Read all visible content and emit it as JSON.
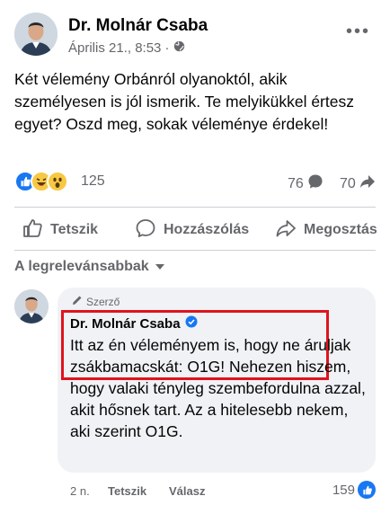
{
  "post": {
    "author": "Dr. Molnár Csaba",
    "timestamp": "Április 21., 8:53 ·",
    "privacy_icon": "globe-icon",
    "more_label": "•••",
    "text": "Két vélemény Orbánról olyanoktól, akik személyesen is jól ismerik. Te melyikükkel értesz egyet? Oszd meg, sokak véleménye érdekel!"
  },
  "stats": {
    "reactions": [
      "like",
      "haha",
      "wow"
    ],
    "reaction_count": "125",
    "comment_count": "76",
    "share_count": "70"
  },
  "actions": {
    "like": "Tetszik",
    "comment": "Hozzászólás",
    "share": "Megosztás"
  },
  "sort": {
    "label": "A legrelevánsabbak"
  },
  "comment": {
    "badge": "Szerző",
    "author": "Dr. Molnár Csaba",
    "verified": true,
    "text": "Itt az én véleményem is, hogy ne áruljak zsákbamacskát: O1G! Nehezen hiszem, hogy valaki tényleg szembefordulna azzal, akit hősnek tart. Az a hitelesebb nekem, aki szerint O1G.",
    "time": "2 n.",
    "like_label": "Tetszik",
    "reply_label": "Válasz",
    "reaction_count": "159"
  },
  "colors": {
    "highlight": "#e0131d",
    "like_blue": "#1877f2",
    "secondary_text": "#65676b",
    "bubble_bg": "#f0f2f5"
  }
}
